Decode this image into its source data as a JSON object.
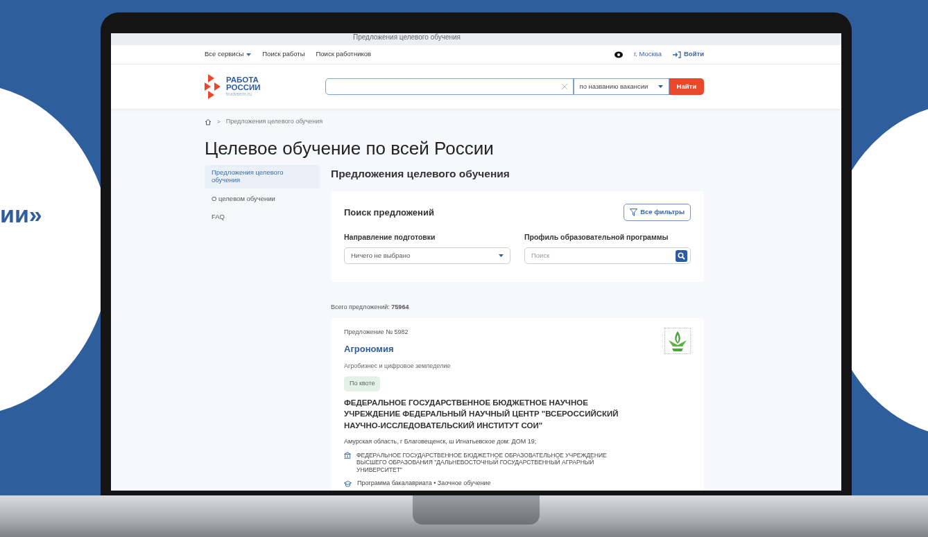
{
  "side_caption": "ии»",
  "browser_tab": {
    "title": "Предложения целевого обучения"
  },
  "top_nav": {
    "items": [
      {
        "label": "Все сервисы",
        "dropdown": true
      },
      {
        "label": "Поиск работы",
        "dropdown": false
      },
      {
        "label": "Поиск работников",
        "dropdown": false
      }
    ],
    "city": "г. Москва",
    "login": "Войти"
  },
  "header": {
    "logo": {
      "line1": "РАБОТА",
      "line2": "РОССИИ",
      "domain": "trudvsem.ru"
    },
    "search": {
      "mode": "по названию вакансии",
      "button": "Найти"
    }
  },
  "breadcrumb_separator": ">",
  "breadcrumb": [
    "Предложения целевого обучения"
  ],
  "page_title": "Целевое обучение по всей России",
  "sidebar": {
    "items": [
      {
        "label": "Предложения целевого обучения",
        "selected": true
      },
      {
        "label": "О целевом обучении",
        "selected": false
      },
      {
        "label": "FAQ",
        "selected": false
      }
    ]
  },
  "section_title": "Предложения целевого обучения",
  "search_panel": {
    "title": "Поиск предложений",
    "filters_button": "Все фильтры",
    "fields": [
      {
        "kind": "select",
        "label": "Направление подготовки",
        "value": "Ничего не выбрано"
      },
      {
        "kind": "search",
        "label": "Профиль образовательной программы",
        "placeholder": "Поиск"
      }
    ]
  },
  "total": {
    "label": "Всего предложений:",
    "value": "75964"
  },
  "offers": [
    {
      "number": "Предложение № 5982",
      "title": "Агрономия",
      "profile": "Агробизнес и цифровое земледелие",
      "tag": "По квоте",
      "employer": "ФЕДЕРАЛЬНОЕ ГОСУДАРСТВЕННОЕ БЮДЖЕТНОЕ НАУЧНОЕ УЧРЕЖДЕНИЕ ФЕДЕРАЛЬНЫЙ НАУЧНЫЙ ЦЕНТР \"ВСЕРОССИЙСКИЙ НАУЧНО-ИССЛЕДОВАТЕЛЬСКИЙ ИНСТИТУТ СОИ\"",
      "address": "Амурская область, г Благовещенск, ш Игнатьевское дом: ДОМ 19;",
      "university": "ФЕДЕРАЛЬНОЕ ГОСУДАРСТВЕННОЕ БЮДЖЕТНОЕ ОБРАЗОВАТЕЛЬНОЕ УЧРЕЖДЕНИЕ ВЫСШЕГО ОБРАЗОВАНИЯ \"ДАЛЬНЕВОСТОЧНЫЙ ГОСУДАРСТВЕННЫЙ АГРАРНЫЙ УНИВЕРСИТЕТ\"",
      "program": [
        "Программа бакалавриата",
        "Заочное обучение"
      ],
      "separator": "•"
    }
  ]
}
